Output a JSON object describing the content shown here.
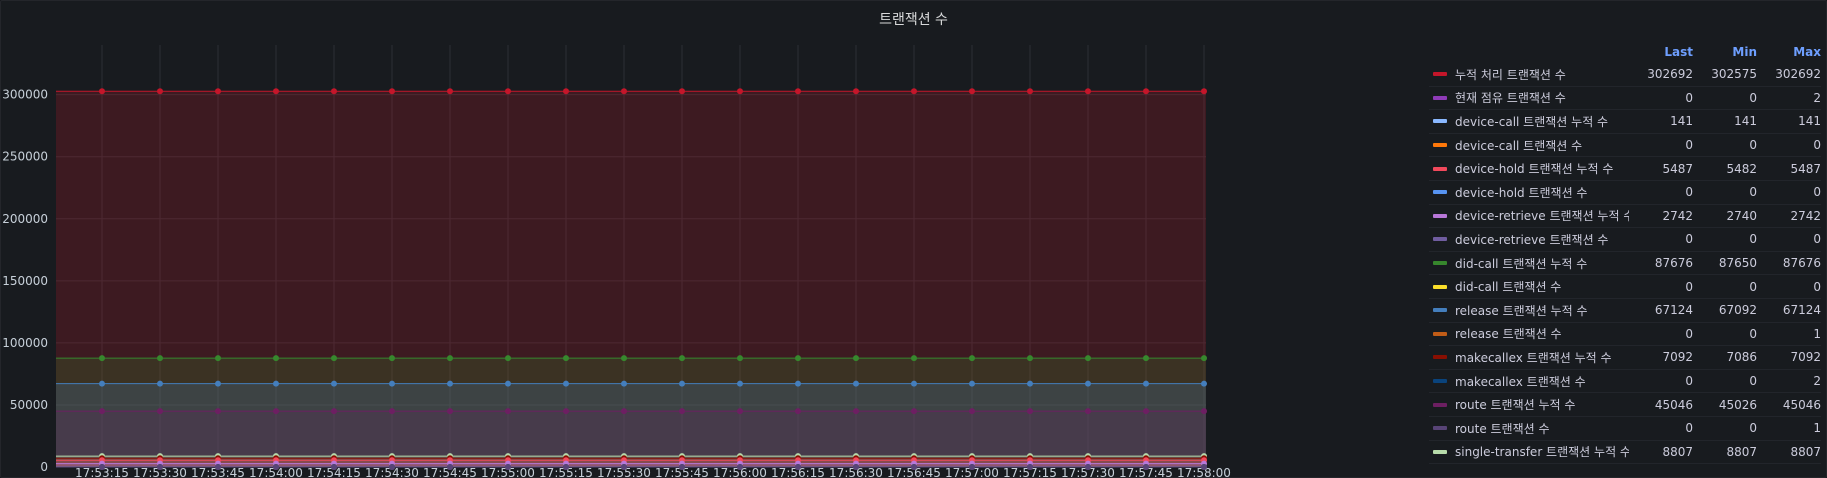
{
  "panel": {
    "title": "트랜잭션 수"
  },
  "legend": {
    "headers": {
      "last": "Last",
      "min": "Min",
      "max": "Max"
    }
  },
  "chart_data": {
    "type": "area",
    "title": "트랜잭션 수",
    "x": [
      "17:53:15",
      "17:53:30",
      "17:53:45",
      "17:54:00",
      "17:54:15",
      "17:54:30",
      "17:54:45",
      "17:55:00",
      "17:55:15",
      "17:55:30",
      "17:55:45",
      "17:56:00",
      "17:56:15",
      "17:56:30",
      "17:56:45",
      "17:57:00",
      "17:57:15",
      "17:57:30",
      "17:57:45",
      "17:58:00"
    ],
    "y_ticks": [
      "0",
      "50000",
      "100000",
      "150000",
      "200000",
      "250000",
      "300000"
    ],
    "ylim": [
      0,
      340000
    ],
    "grid": true,
    "legend_placement": "right",
    "series": [
      {
        "name": "누적 처리 트랜잭션 수",
        "color": "#c4162a",
        "last": "302692",
        "min": "302575",
        "max": "302692",
        "value": 302692
      },
      {
        "name": "현재 점유 트랜잭션 수",
        "color": "#8f3bb8",
        "last": "0",
        "min": "0",
        "max": "2",
        "value": 0
      },
      {
        "name": "device-call 트랜잭션 누적 수",
        "color": "#8ab8ff",
        "last": "141",
        "min": "141",
        "max": "141",
        "value": 141
      },
      {
        "name": "device-call 트랜잭션 수",
        "color": "#ff780a",
        "last": "0",
        "min": "0",
        "max": "0",
        "value": 0
      },
      {
        "name": "device-hold 트랜잭션 누적 수",
        "color": "#f2495c",
        "last": "5487",
        "min": "5482",
        "max": "5487",
        "value": 5487
      },
      {
        "name": "device-hold 트랜잭션 수",
        "color": "#5794f2",
        "last": "0",
        "min": "0",
        "max": "0",
        "value": 0
      },
      {
        "name": "device-retrieve 트랜잭션 누적 수",
        "color": "#b877d9",
        "last": "2742",
        "min": "2740",
        "max": "2742",
        "value": 2742
      },
      {
        "name": "device-retrieve 트랜잭션 수",
        "color": "#705da0",
        "last": "0",
        "min": "0",
        "max": "0",
        "value": 0
      },
      {
        "name": "did-call 트랜잭션 누적 수",
        "color": "#37872d",
        "last": "87676",
        "min": "87650",
        "max": "87676",
        "value": 87676
      },
      {
        "name": "did-call 트랜잭션 수",
        "color": "#fade2a",
        "last": "0",
        "min": "0",
        "max": "0",
        "value": 0
      },
      {
        "name": "release 트랜잭션 누적 수",
        "color": "#447ebc",
        "last": "67124",
        "min": "67092",
        "max": "67124",
        "value": 67124
      },
      {
        "name": "release 트랜잭션 수",
        "color": "#c15c17",
        "last": "0",
        "min": "0",
        "max": "1",
        "value": 0
      },
      {
        "name": "makecallex 트랜잭션 누적 수",
        "color": "#890f02",
        "last": "7092",
        "min": "7086",
        "max": "7092",
        "value": 7092
      },
      {
        "name": "makecallex 트랜잭션 수",
        "color": "#0a437c",
        "last": "0",
        "min": "0",
        "max": "2",
        "value": 0
      },
      {
        "name": "route 트랜잭션 누적 수",
        "color": "#6d1f62",
        "last": "45046",
        "min": "45026",
        "max": "45046",
        "value": 45046
      },
      {
        "name": "route 트랜잭션 수",
        "color": "#584477",
        "last": "0",
        "min": "0",
        "max": "1",
        "value": 0
      },
      {
        "name": "single-transfer 트랜잭션 누적 수",
        "color": "#b7dbab",
        "last": "8807",
        "min": "8807",
        "max": "8807",
        "value": 8807
      }
    ]
  }
}
